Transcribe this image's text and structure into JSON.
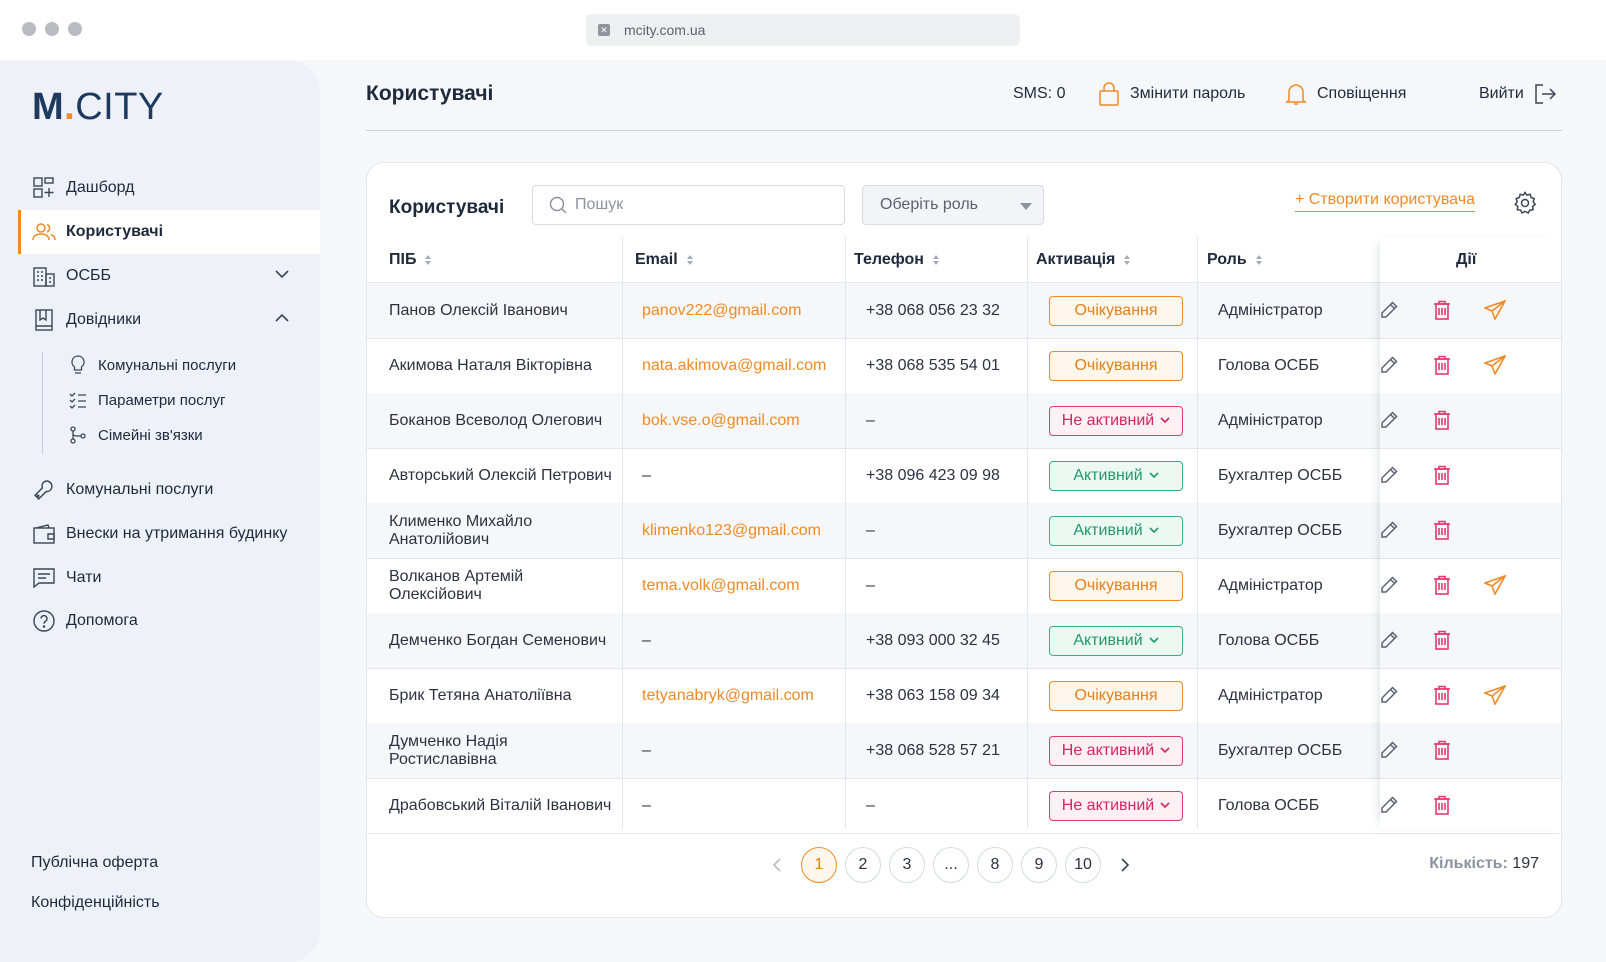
{
  "browser": {
    "url": "mcity.com.ua"
  },
  "logo": {
    "part1": "M",
    "dot": ".",
    "part2": "CITY"
  },
  "sidebar": {
    "items": [
      {
        "label": "Дашборд",
        "icon": "dashboard-icon"
      },
      {
        "label": "Користувачі",
        "icon": "users-icon",
        "active": true
      },
      {
        "label": "ОСББ",
        "icon": "building-icon",
        "expanded": false
      },
      {
        "label": "Довідники",
        "icon": "book-icon",
        "expanded": true
      },
      {
        "label": "Комунальні послуги",
        "icon": "wrench-icon"
      },
      {
        "label": "Внески на утримання будинку",
        "icon": "wallet-icon"
      },
      {
        "label": "Чати",
        "icon": "chat-icon"
      },
      {
        "label": "Допомога",
        "icon": "help-icon"
      }
    ],
    "subitems": [
      {
        "label": "Комунальні послуги",
        "icon": "lightbulb-icon"
      },
      {
        "label": "Параметри послуг",
        "icon": "checklist-icon"
      },
      {
        "label": "Сімейні зв'язки",
        "icon": "branch-icon"
      }
    ],
    "footer": {
      "offer": "Публічна оферта",
      "privacy": "Конфіденційність"
    }
  },
  "header": {
    "title": "Користувачі",
    "sms": "SMS: 0",
    "change_password": "Змінити пароль",
    "notifications": "Сповіщення",
    "logout": "Вийти"
  },
  "card": {
    "title": "Користувачі",
    "search_placeholder": "Пошук",
    "role_select": "Оберіть роль",
    "create_user": "+ Створити користувача"
  },
  "table": {
    "columns": [
      "ПІБ",
      "Email",
      "Телефон",
      "Активація",
      "Роль",
      "Дії"
    ],
    "rows": [
      {
        "name": "Панов Олексій Іванович",
        "email": "panov222@gmail.com",
        "phone": "+38 068 056 23 32",
        "status": "Очікування",
        "status_type": "pending",
        "role": "Адміністратор",
        "send": true
      },
      {
        "name": "Акимова Наталя Вікторівна",
        "email": "nata.akimova@gmail.com",
        "phone": "+38 068 535 54 01",
        "status": "Очікування",
        "status_type": "pending",
        "role": "Голова ОСББ",
        "send": true
      },
      {
        "name": "Боканов Всеволод Олегович",
        "email": "bok.vse.o@gmail.com",
        "phone": "–",
        "status": "Не активний",
        "status_type": "inactive",
        "role": "Адміністратор",
        "send": false
      },
      {
        "name": "Авторський Олексій Петрович",
        "email": "–",
        "phone": "+38 096 423 09 98",
        "status": "Активний",
        "status_type": "active",
        "role": "Бухгалтер ОСББ",
        "send": false
      },
      {
        "name": "Клименко Михайло Анатолійович",
        "email": "klimenko123@gmail.com",
        "phone": "–",
        "status": "Активний",
        "status_type": "active",
        "role": "Бухгалтер ОСББ",
        "send": false
      },
      {
        "name": "Волканов Артемій Олексійович",
        "email": "tema.volk@gmail.com",
        "phone": "–",
        "status": "Очікування",
        "status_type": "pending",
        "role": "Адміністратор",
        "send": true
      },
      {
        "name": "Демченко Богдан Семенович",
        "email": "–",
        "phone": "+38 093 000 32 45",
        "status": "Активний",
        "status_type": "active",
        "role": "Голова ОСББ",
        "send": false
      },
      {
        "name": "Брик Тетяна Анатоліївна",
        "email": "tetyanabryk@gmail.com",
        "phone": "+38 063 158 09 34",
        "status": "Очікування",
        "status_type": "pending",
        "role": "Адміністратор",
        "send": true
      },
      {
        "name": "Думченко Надія Ростиславівна",
        "email": "–",
        "phone": "+38 068 528 57 21",
        "status": "Не активний",
        "status_type": "inactive",
        "role": "Бухгалтер ОСББ",
        "send": false
      },
      {
        "name": "Драбовський Віталій Іванович",
        "email": "–",
        "phone": "–",
        "status": "Не активний",
        "status_type": "inactive",
        "role": "Голова ОСББ",
        "send": false
      }
    ]
  },
  "pagination": {
    "pages": [
      "1",
      "2",
      "3",
      "...",
      "8",
      "9",
      "10"
    ],
    "current": "1",
    "count_label": "Кількість:",
    "count_value": "197"
  },
  "colors": {
    "accent": "#f08a24",
    "danger": "#e43a6c",
    "success": "#35b07e",
    "navy": "#1e3a5f"
  }
}
